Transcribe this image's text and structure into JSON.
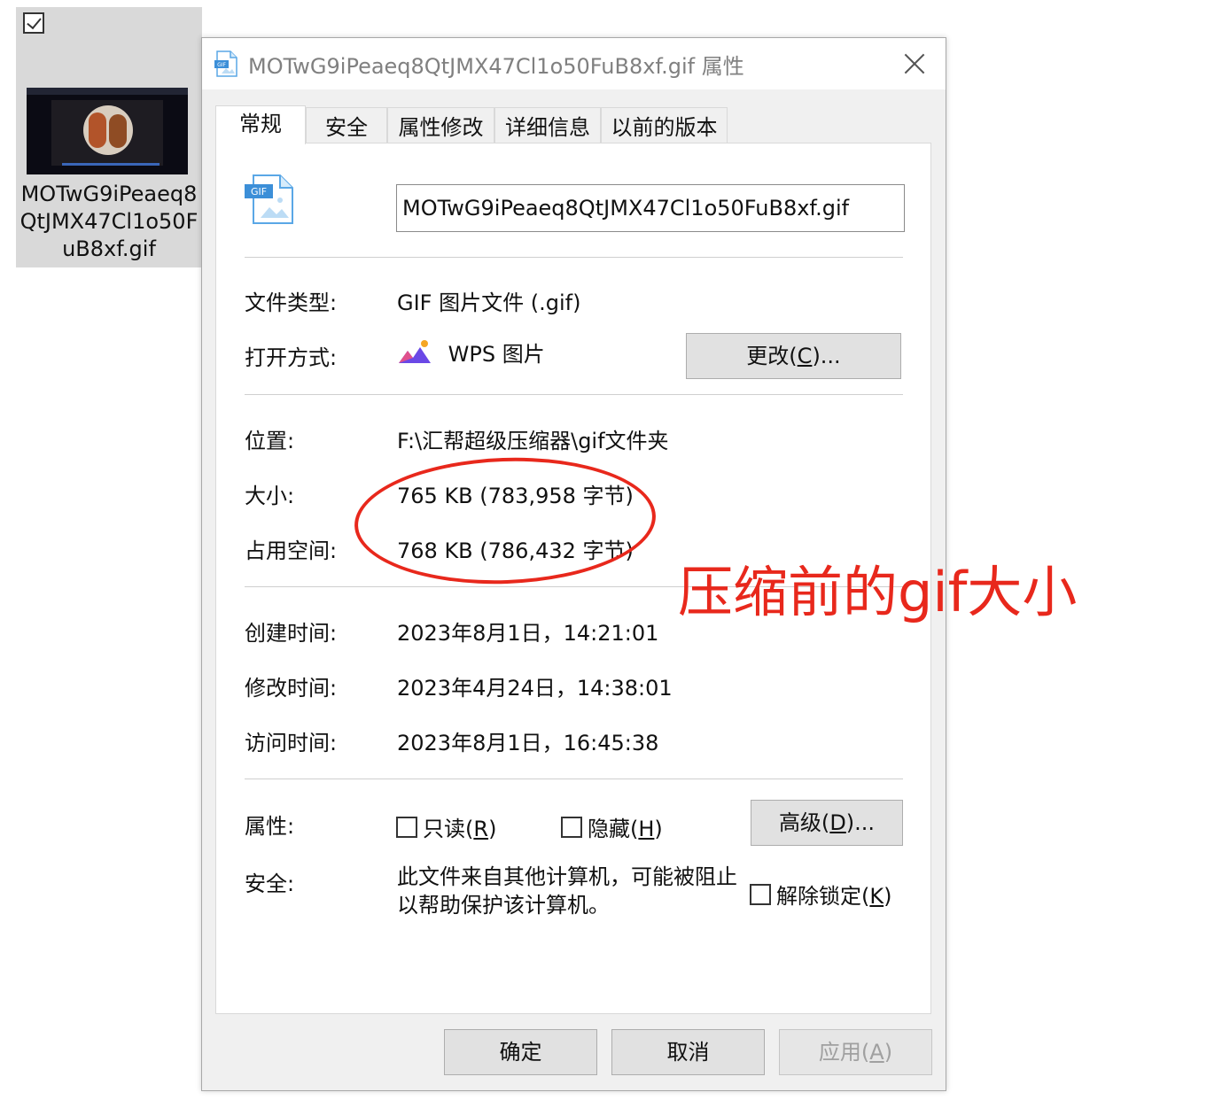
{
  "desktop_tile": {
    "file_name": "MOTwG9iPeaeq8QtJMX47Cl1o50FuB8xf.gif",
    "checkbox_checked": true
  },
  "dialog": {
    "title": "MOTwG9iPeaeq8QtJMX47Cl1o50FuB8xf.gif 属性",
    "tabs": [
      {
        "label": "常规",
        "active": true
      },
      {
        "label": "安全",
        "active": false
      },
      {
        "label": "属性修改",
        "active": false
      },
      {
        "label": "详细信息",
        "active": false
      },
      {
        "label": "以前的版本",
        "active": false
      }
    ],
    "icon_badge": "GIF",
    "file_name_value": "MOTwG9iPeaeq8QtJMX47Cl1o50FuB8xf.gif",
    "file_type": {
      "label": "文件类型:",
      "value": "GIF 图片文件 (.gif)"
    },
    "open_with": {
      "label": "打开方式:",
      "value": "WPS 图片",
      "change_button": "更改(C)...",
      "change_button_pre": "更改(",
      "change_button_key": "C",
      "change_button_post": ")..."
    },
    "location": {
      "label": "位置:",
      "value": "F:\\汇帮超级压缩器\\gif文件夹"
    },
    "size": {
      "label": "大小:",
      "value": "765 KB (783,958 字节)"
    },
    "size_on_disk": {
      "label": "占用空间:",
      "value": "768 KB (786,432 字节)"
    },
    "created": {
      "label": "创建时间:",
      "value": "2023年8月1日，14:21:01"
    },
    "modified": {
      "label": "修改时间:",
      "value": "2023年4月24日，14:38:01"
    },
    "accessed": {
      "label": "访问时间:",
      "value": "2023年8月1日，16:45:38"
    },
    "attributes": {
      "label": "属性:",
      "readonly": {
        "pre": "只读(",
        "key": "R",
        "post": ")",
        "checked": false
      },
      "hidden": {
        "pre": "隐藏(",
        "key": "H",
        "post": ")",
        "checked": false
      },
      "advanced": {
        "pre": "高级(",
        "key": "D",
        "post": ")..."
      }
    },
    "security": {
      "label": "安全:",
      "text": "此文件来自其他计算机，可能被阻止以帮助保护该计算机。",
      "unblock": {
        "pre": "解除锁定(",
        "key": "K",
        "post": ")",
        "checked": false
      }
    },
    "buttons": {
      "ok": "确定",
      "cancel": "取消",
      "apply_pre": "应用(",
      "apply_key": "A",
      "apply_post": ")"
    }
  },
  "annotation": {
    "text": "压缩前的gif大小",
    "color": "#e8281c"
  }
}
